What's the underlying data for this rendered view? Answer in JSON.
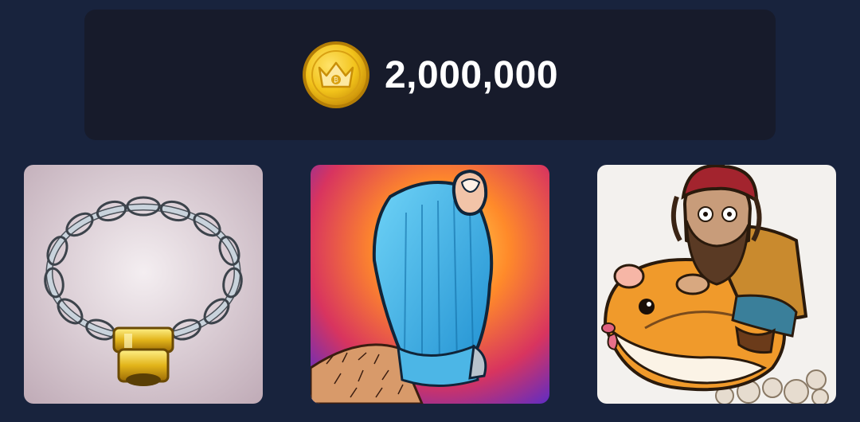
{
  "balance": {
    "amount": "2,000,000",
    "coin_icon": "crown-coin-icon",
    "coin_symbol": "₿"
  },
  "cards": [
    {
      "icon": "chain-necklace-icon",
      "accent": "#c9b8c4"
    },
    {
      "icon": "torn-sock-foot-icon",
      "accent": "#f05a3a"
    },
    {
      "icon": "man-riding-hamster-icon",
      "accent": "#f3f1ee"
    }
  ],
  "colors": {
    "background": "#18233d",
    "panel": "#171b2b",
    "text": "#ffffff",
    "coin": "#f2c31b"
  }
}
